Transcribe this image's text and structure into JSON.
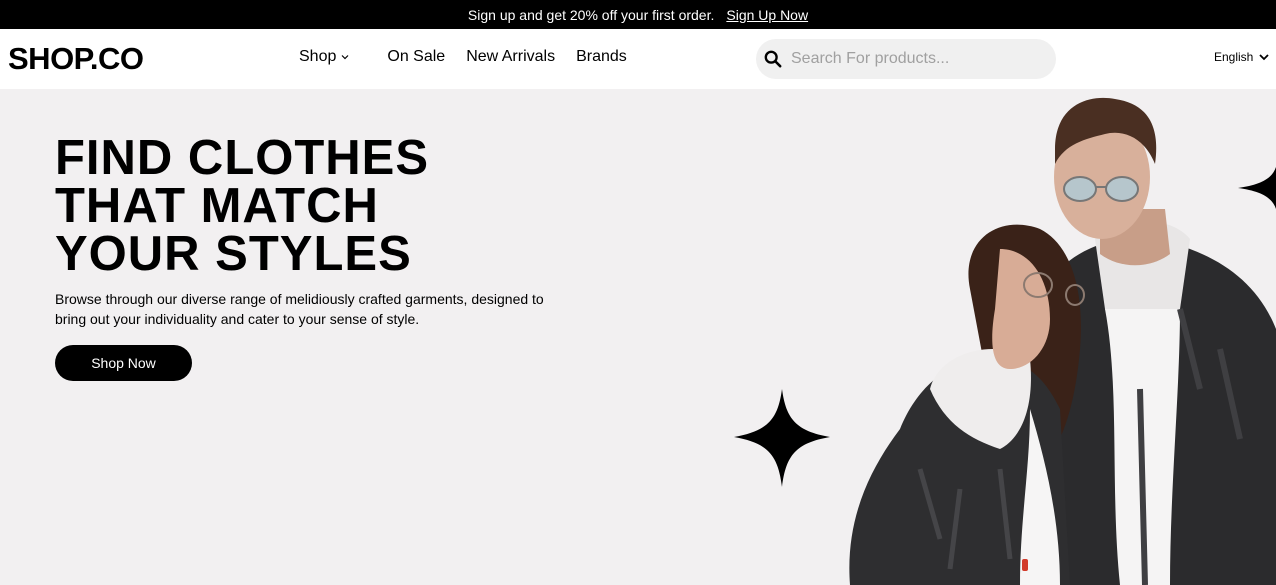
{
  "promo": {
    "text": "Sign up and get 20% off your first order.",
    "link": "Sign Up Now"
  },
  "header": {
    "logo": "SHOP.CO",
    "nav": {
      "shop": "Shop",
      "on_sale": "On Sale",
      "new_arrivals": "New Arrivals",
      "brands": "Brands"
    },
    "search": {
      "placeholder": "Search For products..."
    },
    "language": "English"
  },
  "hero": {
    "title_lines": [
      "FIND CLOTHES",
      "THAT MATCH",
      "YOUR STYLES"
    ],
    "description": "Browse through our diverse range of melidiously crafted garments, designed to bring out your individuality and cater to your sense of style.",
    "button": "Shop Now"
  },
  "colors": {
    "promo_bg": "#000000",
    "hero_bg": "#f2f0f1",
    "button_bg": "#000000",
    "search_bg": "#f0f0f0"
  },
  "icons": {
    "search": "search-icon",
    "shop_dropdown": "chevron-down-icon",
    "language_dropdown": "chevron-down-icon",
    "sparkle": "sparkle-star-icon"
  }
}
